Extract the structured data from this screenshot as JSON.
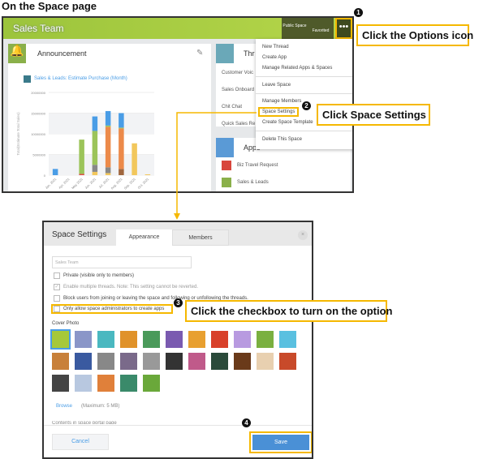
{
  "heading": "On the Space page",
  "space": {
    "title": "Sales Team",
    "public_space": "Public Space",
    "favorited": "Favorited",
    "options_icon": "more-horizontal-icon",
    "announcement": "Announcement",
    "chart_link": "Sales & Leads: Estimate Purchase (Month)",
    "threads_title": "Thr",
    "threads": [
      "Customer Voic",
      "Sales Onboard",
      "Chit Chat",
      "Quick Sales Re"
    ],
    "apps_title": "Apps",
    "apps": [
      "Biz Travel Request",
      "Sales & Leads"
    ]
  },
  "menu": {
    "items": [
      "New Thread",
      "Create App",
      "Manage Related Apps & Spaces",
      "Leave Space",
      "Manage Members",
      "Space Settings",
      "Create Space Template",
      "Delete This Space"
    ]
  },
  "callouts": {
    "c1": "Click the Options icon",
    "c2": "Click Space Settings",
    "c3": "Click the checkbox to turn on the option",
    "badges": [
      "1",
      "2",
      "3",
      "4"
    ]
  },
  "accent": "#f5b800",
  "dialog": {
    "title": "Space Settings",
    "tabs": [
      "Appearance",
      "Members"
    ],
    "close": "×",
    "name_placeholder": "Sales Team",
    "options": [
      {
        "label": "Private (visible only to members)",
        "checked": false
      },
      {
        "label": "Enable multiple threads. Note: This setting cannot be reverted.",
        "checked": true,
        "disabled": true
      },
      {
        "label": "Block users from joining or leaving the space and following or unfollowing the threads.",
        "checked": false
      },
      {
        "label": "Only allow space administrators to create apps",
        "checked": false
      }
    ],
    "cover_photo": "Cover Photo",
    "browse": "Browse",
    "max": "(Maximum: 5 MB)",
    "contents_label": "Contents in space portal page",
    "cancel": "Cancel",
    "save": "Save"
  },
  "chart_data": {
    "type": "bar",
    "stacked": true,
    "ylabel": "Total(Estimate Total Sales)",
    "ylim": [
      0,
      20000000
    ],
    "yticks": [
      "0",
      "5000000",
      "10000000",
      "15000000",
      "20000000"
    ],
    "categories": [
      "Jan. 2021",
      "Apr. 2021",
      "May 2021",
      "Jun. 2021",
      "Jul. 2021",
      "Aug. 2021",
      "Sep. 2021",
      "Oct. 2021"
    ],
    "series": [
      {
        "color": "#f2c75c",
        "values": [
          0,
          0,
          0,
          800000,
          500000,
          0,
          7700000,
          200000
        ]
      },
      {
        "color": "#e0504a",
        "values": [
          0,
          0,
          300000,
          0,
          0,
          0,
          0,
          0
        ]
      },
      {
        "color": "#a0673f",
        "values": [
          0,
          0,
          0,
          0,
          0,
          1500000,
          0,
          0
        ]
      },
      {
        "color": "#888888",
        "values": [
          0,
          0,
          0,
          1700000,
          1400000,
          0,
          0,
          0
        ]
      },
      {
        "color": "#ec8a4a",
        "values": [
          0,
          0,
          0,
          0,
          9800000,
          9800000,
          0,
          0
        ]
      },
      {
        "color": "#9cc45a",
        "values": [
          0,
          0,
          8300000,
          8200000,
          300000,
          200000,
          0,
          0
        ]
      },
      {
        "color": "#4a9de6",
        "values": [
          1500000,
          0,
          0,
          3500000,
          3500000,
          3500000,
          0,
          0
        ]
      }
    ]
  }
}
